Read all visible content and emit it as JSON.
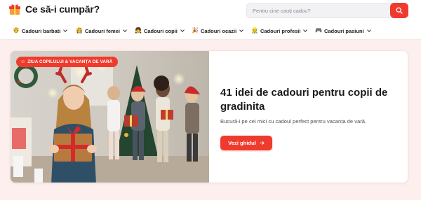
{
  "header": {
    "logo_text": "Ce să-i cumpăr?",
    "search_placeholder": "Pentru cine cauți cadou?"
  },
  "nav": [
    {
      "icon": "crown-emoji",
      "glyph": "🤴",
      "label": "Cadouri barbati"
    },
    {
      "icon": "woman-emoji",
      "glyph": "👸",
      "label": "Cadouri femei"
    },
    {
      "icon": "child-emoji",
      "glyph": "👧",
      "label": "Cadouri copii"
    },
    {
      "icon": "party-emoji",
      "glyph": "🎉",
      "label": "Cadouri ocazii"
    },
    {
      "icon": "worker-emoji",
      "glyph": "👷",
      "label": "Cadouri profesii"
    },
    {
      "icon": "gamepad-emoji",
      "glyph": "🎮",
      "label": "Cadouri pasiuni"
    }
  ],
  "hero": {
    "badge": "ZIUA COPILULUI & VACANȚA DE VARĂ",
    "badge_icon": "child-emoji",
    "title": "41 idei de cadouri pentru copii de gradinita",
    "description": "Bucură-i pe cei mici cu cadoul perfect pentru vacanța de vară.",
    "cta_label": "Vezi ghidul",
    "cta_icon": "arrow-right-icon"
  },
  "colors": {
    "accent": "#ef3b2d",
    "band_background": "#fcefed",
    "card_background": "#ffffff"
  }
}
